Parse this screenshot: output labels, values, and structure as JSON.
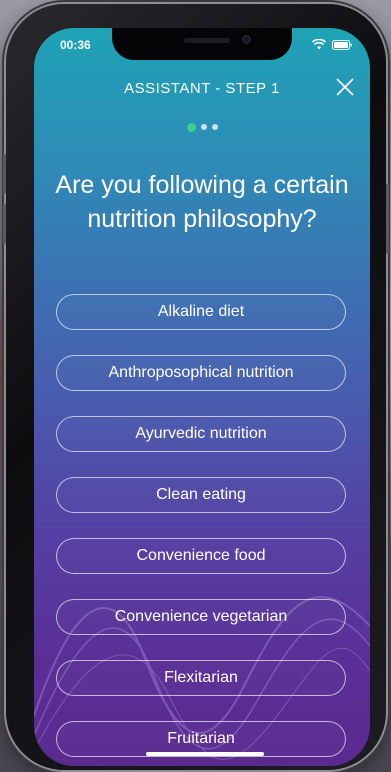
{
  "status_bar": {
    "time": "00:36",
    "icons": [
      "wifi-icon",
      "battery-icon"
    ]
  },
  "header": {
    "title": "ASSISTANT - STEP 1",
    "close_icon": "close-icon"
  },
  "progress": {
    "total_steps": 3,
    "current_step": 1
  },
  "question": "Are you following a certain nutrition philosophy?",
  "options": [
    "Alkaline diet",
    "Anthroposophical nutrition",
    "Ayurvedic nutrition",
    "Clean eating",
    "Convenience food",
    "Convenience vegetarian",
    "Flexitarian",
    "Fruitarian"
  ],
  "colors": {
    "gradient_top": "#1ea3b6",
    "gradient_bottom": "#5a2a8f",
    "active_dot": "#3dcf8e"
  }
}
